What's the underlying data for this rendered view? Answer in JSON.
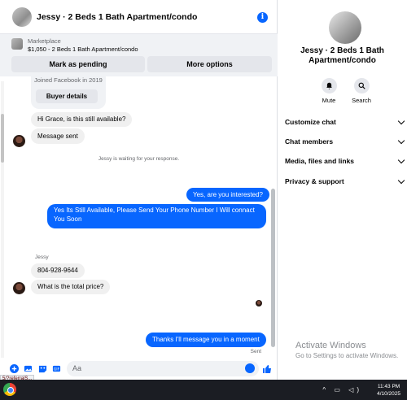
{
  "header": {
    "title": "Jessy · 2 Beds 1 Bath Apartment/condo",
    "info_glyph": "i"
  },
  "marketplace": {
    "label": "Marketplace",
    "listing": "$1,050 - 2 Beds 1 Bath Apartment/condo",
    "mark_pending": "Mark as pending",
    "more_options": "More options"
  },
  "card": {
    "joined": "Joined Facebook in 2019",
    "buyer_details": "Buyer details"
  },
  "messages": {
    "m1": "Hi Grace, is this still available?",
    "m2": "Message sent",
    "waiting": "Jessy is waiting for your response.",
    "m3": "Yes, are you interested?",
    "m4": "Yes Its Still Available, Please Send Your Phone Number I Will connact You Soon",
    "sender": "Jessy",
    "m5": "804-928-9644",
    "m6": "What is the total price?",
    "m7": "Thanks I'll message you in a moment",
    "status": "Sent"
  },
  "composer": {
    "placeholder": "Aa"
  },
  "sidebar": {
    "name": "Jessy · 2 Beds 1 Bath Apartment/condo",
    "mute": "Mute",
    "search": "Search",
    "items": [
      "Customize chat",
      "Chat members",
      "Media, files and links",
      "Privacy & support"
    ]
  },
  "watermark": {
    "title": "Activate Windows",
    "sub": "Go to Settings to activate Windows."
  },
  "taskbar": {
    "time": "11:43 PM",
    "date": "4/10/2025",
    "url_tip": "5/?referralS..."
  },
  "colors": {
    "accent": "#0866ff",
    "bubble_in": "#f0f0f0"
  }
}
